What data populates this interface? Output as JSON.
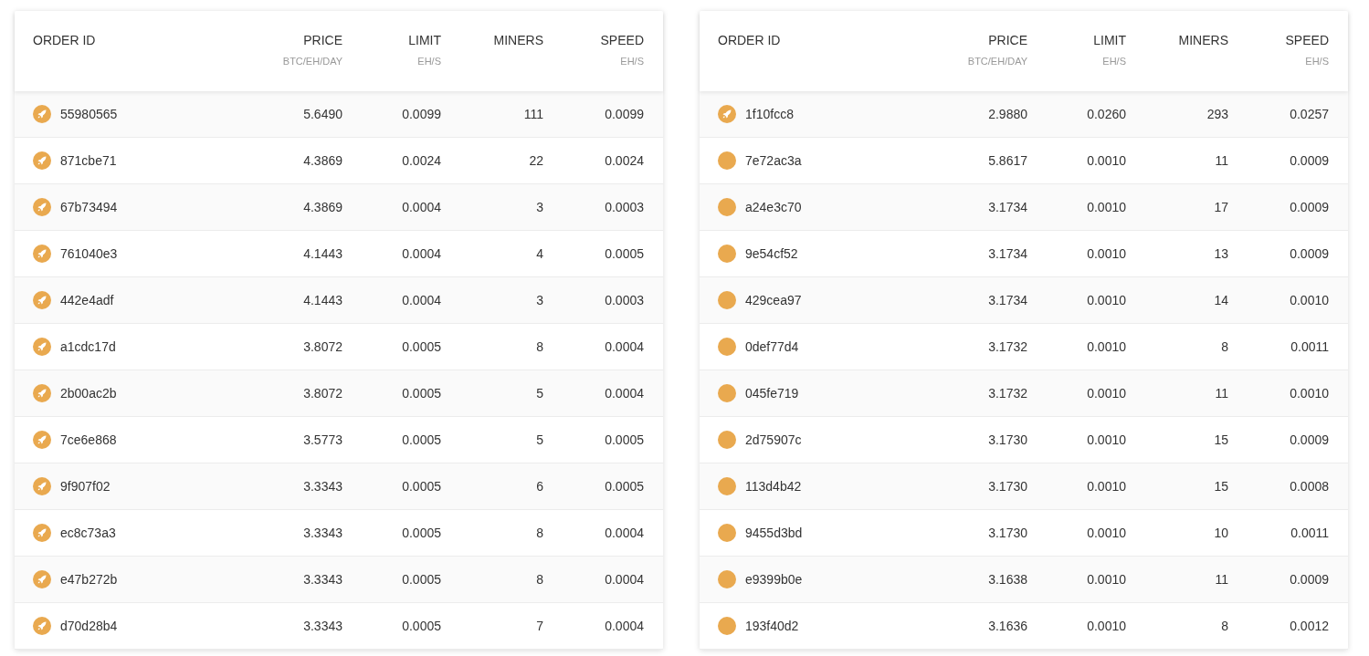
{
  "tables": [
    {
      "columns": [
        {
          "label": "ORDER ID"
        },
        {
          "label": "PRICE",
          "unit": "BTC/EH/DAY"
        },
        {
          "label": "LIMIT",
          "unit": "EH/S"
        },
        {
          "label": "MINERS"
        },
        {
          "label": "SPEED",
          "unit": "EH/S"
        }
      ],
      "rows": [
        {
          "kind": "rocket",
          "order_id": "55980565",
          "price": "5.6490",
          "limit": "0.0099",
          "miners": "111",
          "speed": "0.0099"
        },
        {
          "kind": "rocket",
          "order_id": "871cbe71",
          "price": "4.3869",
          "limit": "0.0024",
          "miners": "22",
          "speed": "0.0024"
        },
        {
          "kind": "rocket",
          "order_id": "67b73494",
          "price": "4.3869",
          "limit": "0.0004",
          "miners": "3",
          "speed": "0.0003"
        },
        {
          "kind": "rocket",
          "order_id": "761040e3",
          "price": "4.1443",
          "limit": "0.0004",
          "miners": "4",
          "speed": "0.0005"
        },
        {
          "kind": "rocket",
          "order_id": "442e4adf",
          "price": "4.1443",
          "limit": "0.0004",
          "miners": "3",
          "speed": "0.0003"
        },
        {
          "kind": "rocket",
          "order_id": "a1cdc17d",
          "price": "3.8072",
          "limit": "0.0005",
          "miners": "8",
          "speed": "0.0004"
        },
        {
          "kind": "rocket",
          "order_id": "2b00ac2b",
          "price": "3.8072",
          "limit": "0.0005",
          "miners": "5",
          "speed": "0.0004"
        },
        {
          "kind": "rocket",
          "order_id": "7ce6e868",
          "price": "3.5773",
          "limit": "0.0005",
          "miners": "5",
          "speed": "0.0005"
        },
        {
          "kind": "rocket",
          "order_id": "9f907f02",
          "price": "3.3343",
          "limit": "0.0005",
          "miners": "6",
          "speed": "0.0005"
        },
        {
          "kind": "rocket",
          "order_id": "ec8c73a3",
          "price": "3.3343",
          "limit": "0.0005",
          "miners": "8",
          "speed": "0.0004"
        },
        {
          "kind": "rocket",
          "order_id": "e47b272b",
          "price": "3.3343",
          "limit": "0.0005",
          "miners": "8",
          "speed": "0.0004"
        },
        {
          "kind": "rocket",
          "order_id": "d70d28b4",
          "price": "3.3343",
          "limit": "0.0005",
          "miners": "7",
          "speed": "0.0004"
        }
      ]
    },
    {
      "columns": [
        {
          "label": "ORDER ID"
        },
        {
          "label": "PRICE",
          "unit": "BTC/EH/DAY"
        },
        {
          "label": "LIMIT",
          "unit": "EH/S"
        },
        {
          "label": "MINERS"
        },
        {
          "label": "SPEED",
          "unit": "EH/S"
        }
      ],
      "rows": [
        {
          "kind": "rocket",
          "order_id": "1f10fcc8",
          "price": "2.9880",
          "limit": "0.0260",
          "miners": "293",
          "speed": "0.0257"
        },
        {
          "kind": "plain",
          "order_id": "7e72ac3a",
          "price": "5.8617",
          "limit": "0.0010",
          "miners": "11",
          "speed": "0.0009"
        },
        {
          "kind": "plain",
          "order_id": "a24e3c70",
          "price": "3.1734",
          "limit": "0.0010",
          "miners": "17",
          "speed": "0.0009"
        },
        {
          "kind": "plain",
          "order_id": "9e54cf52",
          "price": "3.1734",
          "limit": "0.0010",
          "miners": "13",
          "speed": "0.0009"
        },
        {
          "kind": "plain",
          "order_id": "429cea97",
          "price": "3.1734",
          "limit": "0.0010",
          "miners": "14",
          "speed": "0.0010"
        },
        {
          "kind": "plain",
          "order_id": "0def77d4",
          "price": "3.1732",
          "limit": "0.0010",
          "miners": "8",
          "speed": "0.0011"
        },
        {
          "kind": "plain",
          "order_id": "045fe719",
          "price": "3.1732",
          "limit": "0.0010",
          "miners": "11",
          "speed": "0.0010"
        },
        {
          "kind": "plain",
          "order_id": "2d75907c",
          "price": "3.1730",
          "limit": "0.0010",
          "miners": "15",
          "speed": "0.0009"
        },
        {
          "kind": "plain",
          "order_id": "113d4b42",
          "price": "3.1730",
          "limit": "0.0010",
          "miners": "15",
          "speed": "0.0008"
        },
        {
          "kind": "plain",
          "order_id": "9455d3bd",
          "price": "3.1730",
          "limit": "0.0010",
          "miners": "10",
          "speed": "0.0011"
        },
        {
          "kind": "plain",
          "order_id": "e9399b0e",
          "price": "3.1638",
          "limit": "0.0010",
          "miners": "11",
          "speed": "0.0009"
        },
        {
          "kind": "plain",
          "order_id": "193f40d2",
          "price": "3.1636",
          "limit": "0.0010",
          "miners": "8",
          "speed": "0.0012"
        }
      ]
    }
  ]
}
